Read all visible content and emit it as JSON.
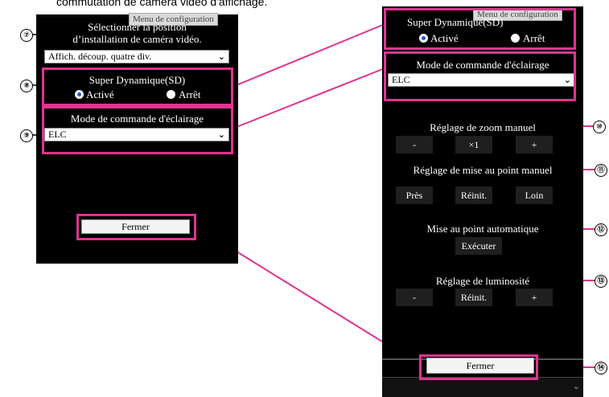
{
  "top_text": "commutation de caméra vidéo d'affichage.",
  "left": {
    "tab": "Menu de configuration",
    "position_label_1": "Sélectionner la position",
    "position_label_2": "d’installation de caméra vidéo.",
    "position_value": "Affich. découp. quatre div.",
    "sd_title": "Super Dynamique(SD)",
    "sd_on": "Activé",
    "sd_off": "Arrêt",
    "light_title": "Mode de commande d'éclairage",
    "light_value": "ELC",
    "close": "Fermer"
  },
  "right": {
    "tab": "Menu de configuration",
    "sd_title": "Super Dynamique(SD)",
    "sd_on": "Activé",
    "sd_off": "Arrêt",
    "light_title": "Mode de commande d'éclairage",
    "light_value": "ELC",
    "zoom_title": "Réglage de zoom manuel",
    "zoom_minus": "-",
    "zoom_x1": "×1",
    "zoom_plus": "+",
    "focus_title": "Réglage de mise au point manuel",
    "focus_near": "Près",
    "focus_reset": "Réinit.",
    "focus_far": "Loin",
    "auto_title": "Mise au point automatique",
    "auto_exec": "Exécuter",
    "bright_title": "Réglage de luminosité",
    "bright_minus": "-",
    "bright_reset": "Réinit.",
    "bright_plus": "+",
    "close": "Fermer"
  },
  "callouts": [
    "⑦",
    "⑧",
    "⑨",
    "⑩",
    "⑪",
    "⑫",
    "⑬",
    "⑭"
  ],
  "colors": {
    "highlight": "#e0338f",
    "panel": "#000000",
    "radio_selected": "#2a57c4"
  }
}
